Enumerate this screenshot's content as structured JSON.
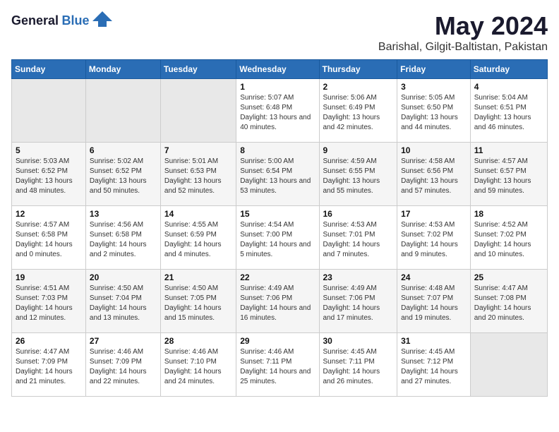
{
  "header": {
    "logo_general": "General",
    "logo_blue": "Blue",
    "title": "May 2024",
    "subtitle": "Barishal, Gilgit-Baltistan, Pakistan"
  },
  "weekdays": [
    "Sunday",
    "Monday",
    "Tuesday",
    "Wednesday",
    "Thursday",
    "Friday",
    "Saturday"
  ],
  "weeks": [
    [
      {
        "day": "",
        "sunrise": "",
        "sunset": "",
        "daylight": ""
      },
      {
        "day": "",
        "sunrise": "",
        "sunset": "",
        "daylight": ""
      },
      {
        "day": "",
        "sunrise": "",
        "sunset": "",
        "daylight": ""
      },
      {
        "day": "1",
        "sunrise": "Sunrise: 5:07 AM",
        "sunset": "Sunset: 6:48 PM",
        "daylight": "Daylight: 13 hours and 40 minutes."
      },
      {
        "day": "2",
        "sunrise": "Sunrise: 5:06 AM",
        "sunset": "Sunset: 6:49 PM",
        "daylight": "Daylight: 13 hours and 42 minutes."
      },
      {
        "day": "3",
        "sunrise": "Sunrise: 5:05 AM",
        "sunset": "Sunset: 6:50 PM",
        "daylight": "Daylight: 13 hours and 44 minutes."
      },
      {
        "day": "4",
        "sunrise": "Sunrise: 5:04 AM",
        "sunset": "Sunset: 6:51 PM",
        "daylight": "Daylight: 13 hours and 46 minutes."
      }
    ],
    [
      {
        "day": "5",
        "sunrise": "Sunrise: 5:03 AM",
        "sunset": "Sunset: 6:52 PM",
        "daylight": "Daylight: 13 hours and 48 minutes."
      },
      {
        "day": "6",
        "sunrise": "Sunrise: 5:02 AM",
        "sunset": "Sunset: 6:52 PM",
        "daylight": "Daylight: 13 hours and 50 minutes."
      },
      {
        "day": "7",
        "sunrise": "Sunrise: 5:01 AM",
        "sunset": "Sunset: 6:53 PM",
        "daylight": "Daylight: 13 hours and 52 minutes."
      },
      {
        "day": "8",
        "sunrise": "Sunrise: 5:00 AM",
        "sunset": "Sunset: 6:54 PM",
        "daylight": "Daylight: 13 hours and 53 minutes."
      },
      {
        "day": "9",
        "sunrise": "Sunrise: 4:59 AM",
        "sunset": "Sunset: 6:55 PM",
        "daylight": "Daylight: 13 hours and 55 minutes."
      },
      {
        "day": "10",
        "sunrise": "Sunrise: 4:58 AM",
        "sunset": "Sunset: 6:56 PM",
        "daylight": "Daylight: 13 hours and 57 minutes."
      },
      {
        "day": "11",
        "sunrise": "Sunrise: 4:57 AM",
        "sunset": "Sunset: 6:57 PM",
        "daylight": "Daylight: 13 hours and 59 minutes."
      }
    ],
    [
      {
        "day": "12",
        "sunrise": "Sunrise: 4:57 AM",
        "sunset": "Sunset: 6:58 PM",
        "daylight": "Daylight: 14 hours and 0 minutes."
      },
      {
        "day": "13",
        "sunrise": "Sunrise: 4:56 AM",
        "sunset": "Sunset: 6:58 PM",
        "daylight": "Daylight: 14 hours and 2 minutes."
      },
      {
        "day": "14",
        "sunrise": "Sunrise: 4:55 AM",
        "sunset": "Sunset: 6:59 PM",
        "daylight": "Daylight: 14 hours and 4 minutes."
      },
      {
        "day": "15",
        "sunrise": "Sunrise: 4:54 AM",
        "sunset": "Sunset: 7:00 PM",
        "daylight": "Daylight: 14 hours and 5 minutes."
      },
      {
        "day": "16",
        "sunrise": "Sunrise: 4:53 AM",
        "sunset": "Sunset: 7:01 PM",
        "daylight": "Daylight: 14 hours and 7 minutes."
      },
      {
        "day": "17",
        "sunrise": "Sunrise: 4:53 AM",
        "sunset": "Sunset: 7:02 PM",
        "daylight": "Daylight: 14 hours and 9 minutes."
      },
      {
        "day": "18",
        "sunrise": "Sunrise: 4:52 AM",
        "sunset": "Sunset: 7:02 PM",
        "daylight": "Daylight: 14 hours and 10 minutes."
      }
    ],
    [
      {
        "day": "19",
        "sunrise": "Sunrise: 4:51 AM",
        "sunset": "Sunset: 7:03 PM",
        "daylight": "Daylight: 14 hours and 12 minutes."
      },
      {
        "day": "20",
        "sunrise": "Sunrise: 4:50 AM",
        "sunset": "Sunset: 7:04 PM",
        "daylight": "Daylight: 14 hours and 13 minutes."
      },
      {
        "day": "21",
        "sunrise": "Sunrise: 4:50 AM",
        "sunset": "Sunset: 7:05 PM",
        "daylight": "Daylight: 14 hours and 15 minutes."
      },
      {
        "day": "22",
        "sunrise": "Sunrise: 4:49 AM",
        "sunset": "Sunset: 7:06 PM",
        "daylight": "Daylight: 14 hours and 16 minutes."
      },
      {
        "day": "23",
        "sunrise": "Sunrise: 4:49 AM",
        "sunset": "Sunset: 7:06 PM",
        "daylight": "Daylight: 14 hours and 17 minutes."
      },
      {
        "day": "24",
        "sunrise": "Sunrise: 4:48 AM",
        "sunset": "Sunset: 7:07 PM",
        "daylight": "Daylight: 14 hours and 19 minutes."
      },
      {
        "day": "25",
        "sunrise": "Sunrise: 4:47 AM",
        "sunset": "Sunset: 7:08 PM",
        "daylight": "Daylight: 14 hours and 20 minutes."
      }
    ],
    [
      {
        "day": "26",
        "sunrise": "Sunrise: 4:47 AM",
        "sunset": "Sunset: 7:09 PM",
        "daylight": "Daylight: 14 hours and 21 minutes."
      },
      {
        "day": "27",
        "sunrise": "Sunrise: 4:46 AM",
        "sunset": "Sunset: 7:09 PM",
        "daylight": "Daylight: 14 hours and 22 minutes."
      },
      {
        "day": "28",
        "sunrise": "Sunrise: 4:46 AM",
        "sunset": "Sunset: 7:10 PM",
        "daylight": "Daylight: 14 hours and 24 minutes."
      },
      {
        "day": "29",
        "sunrise": "Sunrise: 4:46 AM",
        "sunset": "Sunset: 7:11 PM",
        "daylight": "Daylight: 14 hours and 25 minutes."
      },
      {
        "day": "30",
        "sunrise": "Sunrise: 4:45 AM",
        "sunset": "Sunset: 7:11 PM",
        "daylight": "Daylight: 14 hours and 26 minutes."
      },
      {
        "day": "31",
        "sunrise": "Sunrise: 4:45 AM",
        "sunset": "Sunset: 7:12 PM",
        "daylight": "Daylight: 14 hours and 27 minutes."
      },
      {
        "day": "",
        "sunrise": "",
        "sunset": "",
        "daylight": ""
      }
    ]
  ]
}
